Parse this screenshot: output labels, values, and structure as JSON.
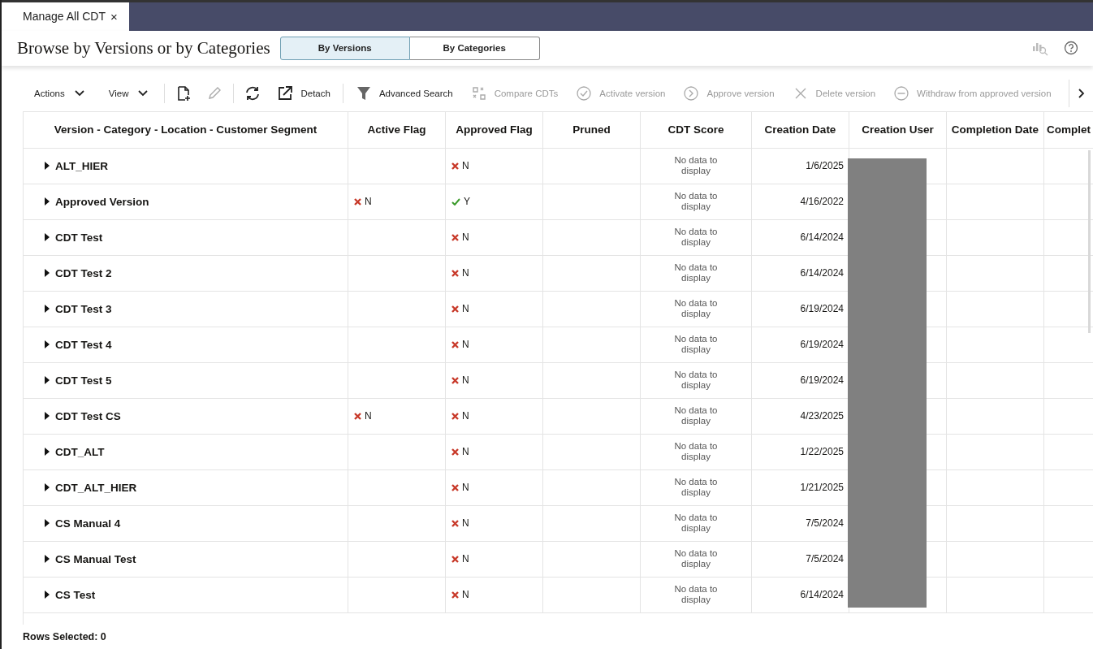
{
  "tabs": [
    {
      "label": "Manage All CDT",
      "close": "×",
      "selected": true
    }
  ],
  "header": {
    "title": "Browse by Versions or by Categories",
    "view_toggle": [
      {
        "label": "By Versions",
        "selected": true
      },
      {
        "label": "By Categories",
        "selected": false
      }
    ]
  },
  "toolbar": [
    {
      "kind": "menu",
      "label": "Actions"
    },
    {
      "kind": "menu",
      "label": "View"
    },
    {
      "kind": "sep"
    },
    {
      "kind": "icon",
      "disabled": false
    },
    {
      "kind": "icon",
      "disabled": true
    },
    {
      "kind": "sep"
    },
    {
      "kind": "icon",
      "disabled": false
    },
    {
      "kind": "button",
      "label": "Detach",
      "disabled": false
    },
    {
      "kind": "sep"
    },
    {
      "kind": "button",
      "label": "Advanced Search",
      "disabled": false
    },
    {
      "kind": "button",
      "label": "Compare CDTs",
      "disabled": true
    },
    {
      "kind": "button",
      "label": "Activate version",
      "disabled": true
    },
    {
      "kind": "button",
      "label": "Approve version",
      "disabled": true
    },
    {
      "kind": "button",
      "label": "Delete version",
      "disabled": true
    },
    {
      "kind": "button",
      "label": "Withdraw from approved version",
      "disabled": true
    }
  ],
  "table": {
    "columns": [
      "Version - Category - Location - Customer Segment",
      "Active Flag",
      "Approved Flag",
      "Pruned",
      "CDT Score",
      "Creation Date",
      "Creation User",
      "Completion Date",
      "Complet"
    ],
    "rows": [
      {
        "name": "ALT_HIER",
        "active_flag": null,
        "approved_flag": {
          "text": "N",
          "checked": false
        },
        "cdt_score": "No data to display",
        "creation_date": "1/6/2025"
      },
      {
        "name": "Approved Version",
        "active_flag": {
          "text": "N",
          "checked": false
        },
        "approved_flag": {
          "text": "Y",
          "checked": true
        },
        "cdt_score": "No data to display",
        "creation_date": "4/16/2022"
      },
      {
        "name": "CDT Test",
        "active_flag": null,
        "approved_flag": {
          "text": "N",
          "checked": false
        },
        "cdt_score": "No data to display",
        "creation_date": "6/14/2024"
      },
      {
        "name": "CDT Test 2",
        "active_flag": null,
        "approved_flag": {
          "text": "N",
          "checked": false
        },
        "cdt_score": "No data to display",
        "creation_date": "6/14/2024"
      },
      {
        "name": "CDT Test 3",
        "active_flag": null,
        "approved_flag": {
          "text": "N",
          "checked": false
        },
        "cdt_score": "No data to display",
        "creation_date": "6/19/2024"
      },
      {
        "name": "CDT Test 4",
        "active_flag": null,
        "approved_flag": {
          "text": "N",
          "checked": false
        },
        "cdt_score": "No data to display",
        "creation_date": "6/19/2024"
      },
      {
        "name": "CDT Test 5",
        "active_flag": null,
        "approved_flag": {
          "text": "N",
          "checked": false
        },
        "cdt_score": "No data to display",
        "creation_date": "6/19/2024"
      },
      {
        "name": "CDT Test CS",
        "active_flag": {
          "text": "N",
          "checked": false
        },
        "approved_flag": {
          "text": "N",
          "checked": false
        },
        "cdt_score": "No data to display",
        "creation_date": "4/23/2025"
      },
      {
        "name": "CDT_ALT",
        "active_flag": null,
        "approved_flag": {
          "text": "N",
          "checked": false
        },
        "cdt_score": "No data to display",
        "creation_date": "1/22/2025"
      },
      {
        "name": "CDT_ALT_HIER",
        "active_flag": null,
        "approved_flag": {
          "text": "N",
          "checked": false
        },
        "cdt_score": "No data to display",
        "creation_date": "1/21/2025"
      },
      {
        "name": "CS Manual 4",
        "active_flag": null,
        "approved_flag": {
          "text": "N",
          "checked": false
        },
        "cdt_score": "No data to display",
        "creation_date": "7/5/2024"
      },
      {
        "name": "CS Manual Test",
        "active_flag": null,
        "approved_flag": {
          "text": "N",
          "checked": false
        },
        "cdt_score": "No data to display",
        "creation_date": "7/5/2024"
      },
      {
        "name": "CS Test",
        "active_flag": null,
        "approved_flag": {
          "text": "N",
          "checked": false
        },
        "cdt_score": "No data to display",
        "creation_date": "6/14/2024"
      }
    ]
  },
  "status_bar": {
    "rows_selected": "Rows Selected: 0"
  }
}
